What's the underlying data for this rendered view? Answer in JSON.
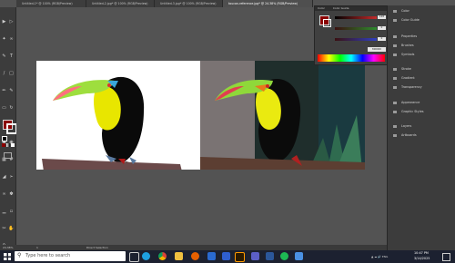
{
  "tabs": [
    "Untitled-1* @ 100% (RGB/Preview)",
    "Untitled-2.jpg* @ 100% (RGB/Preview)",
    "Untitled-3.jpg* @ 100% (RGB/Preview)",
    "toucan-reference.jpg* @ 24.38% (RGB/Preview)"
  ],
  "color_panel": {
    "tabs": [
      "Color",
      "Color Guide"
    ],
    "values": [
      "128",
      "0",
      "0",
      "800000"
    ],
    "colors": {
      "fill": "#8b0000",
      "r_slider": "#c42b2b",
      "g_slider": "#2e8b2e",
      "b_slider": "#3040c0"
    }
  },
  "panels": [
    "Color",
    "Color Guide",
    "Properties",
    "Brushes",
    "Symbols",
    "Stroke",
    "Gradient",
    "Transparency",
    "Appearance",
    "Graphic Styles",
    "Layers",
    "Artboards"
  ],
  "status": {
    "zoom": "24.38%",
    "page": "1",
    "tool": "Direct Selection"
  },
  "taskbar": {
    "search_placeholder": "Type here to search",
    "time": "10:47 PM",
    "date": "3/14/2025"
  },
  "colors": {
    "toolbar_fill": "#8b0000",
    "canvas": "#535353"
  }
}
